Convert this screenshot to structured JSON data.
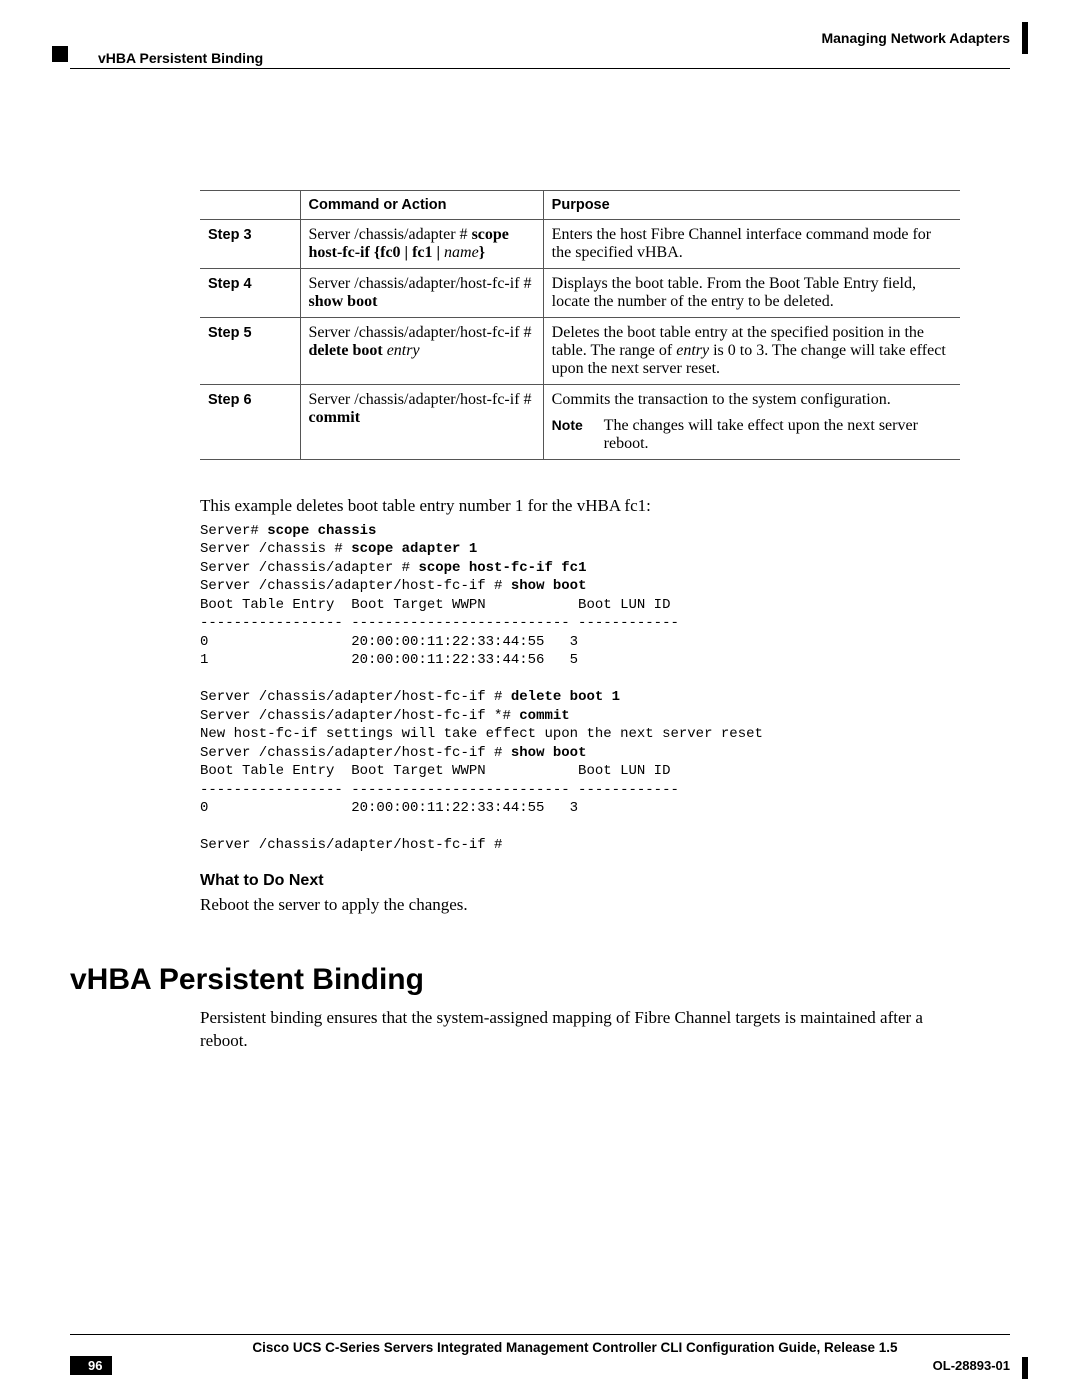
{
  "header": {
    "chapter": "Managing Network Adapters",
    "section": "vHBA Persistent Binding"
  },
  "table": {
    "headers": {
      "cmd": "Command or Action",
      "purpose": "Purpose"
    },
    "rows": [
      {
        "step": "Step 3",
        "cmd_prefix": "Server /chassis/adapter # ",
        "cmd_bold1": "scope host-fc-if",
        "cmd_options": " {fc0 | fc1 | ",
        "cmd_ital": "name",
        "cmd_suffix": "}",
        "purpose": "Enters the host Fibre Channel interface command mode for the specified vHBA."
      },
      {
        "step": "Step 4",
        "cmd_prefix": "Server /chassis/adapter/host-fc-if # ",
        "cmd_bold1": "show boot",
        "purpose": "Displays the boot table. From the Boot Table Entry field, locate the number of the entry to be deleted."
      },
      {
        "step": "Step 5",
        "cmd_prefix": "Server /chassis/adapter/host-fc-if # ",
        "cmd_bold1": "delete boot",
        "cmd_ital": " entry",
        "purpose_pre": "Deletes the boot table entry at the specified position in the table. The range of ",
        "purpose_ital": "entry",
        "purpose_post": " is 0 to 3. The change will take effect upon the next server reset."
      },
      {
        "step": "Step 6",
        "cmd_prefix": "Server /chassis/adapter/host-fc-if # ",
        "cmd_bold1": "commit",
        "purpose": "Commits the transaction to the system configuration.",
        "note_label": "Note",
        "note_body": "The changes will take effect upon the next server reboot."
      }
    ]
  },
  "example_intro": "This example deletes boot table entry number 1 for the vHBA fc1:",
  "code": {
    "l01a": "Server# ",
    "l01b": "scope chassis",
    "l02a": "Server /chassis # ",
    "l02b": "scope adapter 1",
    "l03a": "Server /chassis/adapter # ",
    "l03b": "scope host-fc-if fc1",
    "l04a": "Server /chassis/adapter/host-fc-if # ",
    "l04b": "show boot",
    "l05": "Boot Table Entry  Boot Target WWPN           Boot LUN ID",
    "l06": "----------------- -------------------------- ------------",
    "l07": "0                 20:00:00:11:22:33:44:55   3",
    "l08": "1                 20:00:00:11:22:33:44:56   5",
    "l09": "",
    "l10a": "Server /chassis/adapter/host-fc-if # ",
    "l10b": "delete boot 1",
    "l11a": "Server /chassis/adapter/host-fc-if *# ",
    "l11b": "commit",
    "l12": "New host-fc-if settings will take effect upon the next server reset",
    "l13a": "Server /chassis/adapter/host-fc-if # ",
    "l13b": "show boot",
    "l14": "Boot Table Entry  Boot Target WWPN           Boot LUN ID",
    "l15": "----------------- -------------------------- ------------",
    "l16": "0                 20:00:00:11:22:33:44:55   3",
    "l17": "",
    "l18": "Server /chassis/adapter/host-fc-if #"
  },
  "what_next": {
    "heading": "What to Do Next",
    "body": "Reboot the server to apply the changes."
  },
  "main_section": {
    "title": "vHBA Persistent Binding",
    "body": "Persistent binding ensures that the system-assigned mapping of Fibre Channel targets is maintained after a reboot."
  },
  "footer": {
    "title": "Cisco UCS C-Series Servers Integrated Management Controller CLI Configuration Guide, Release 1.5",
    "page": "96",
    "doc_id": "OL-28893-01"
  }
}
